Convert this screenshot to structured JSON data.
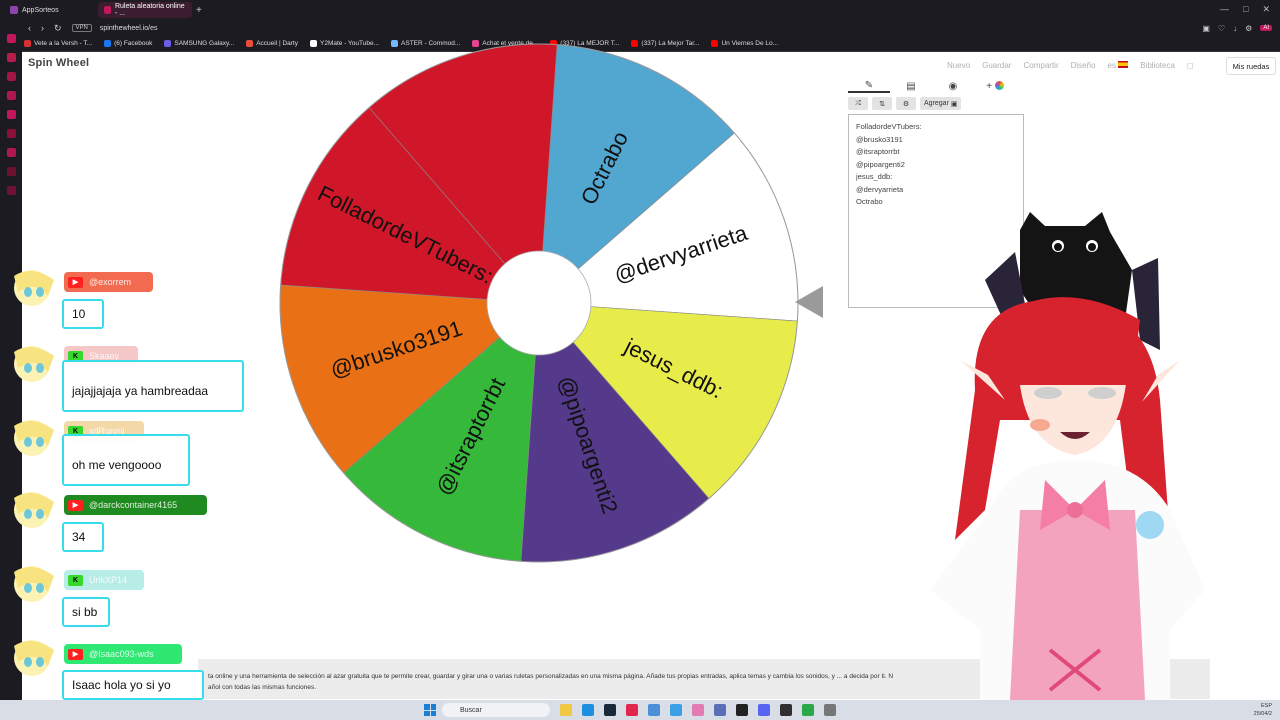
{
  "browser": {
    "tabs": [
      {
        "label": "AppSorteos"
      },
      {
        "label": "Ruleta aleatoria online - ..."
      }
    ],
    "new_tab": "+",
    "address": "spinthewheel.io/es",
    "vpn": "VPN",
    "ai": "AI",
    "bookmarks": [
      {
        "label": "Vete a la Versh - T...",
        "color": "#d63031"
      },
      {
        "label": "(6) Facebook",
        "color": "#1877f2"
      },
      {
        "label": "SAMSUNG Galaxy...",
        "color": "#6c5ce7"
      },
      {
        "label": "Accueil | Darty",
        "color": "#e74c3c"
      },
      {
        "label": "Y2Mate - YouTube...",
        "color": "#fdfdfd"
      },
      {
        "label": "ASTER - Commod...",
        "color": "#2d3436"
      },
      {
        "label": "Achat et vente de...",
        "color": "#e84393"
      },
      {
        "label": "(337) La MEJOR T...",
        "color": "#ff0000"
      },
      {
        "label": "(337) La Mejor Tar...",
        "color": "#ff0000"
      },
      {
        "label": "Un Viernes De Lo...",
        "color": "#ff0000"
      }
    ]
  },
  "site": {
    "logo": "Spin Wheel",
    "nav": {
      "new": "Nuevo",
      "save": "Guardar",
      "share": "Compartir",
      "design": "Diseño",
      "lang": "es",
      "library": "Biblioteca",
      "my_wheels": "Mis ruedas"
    },
    "panel": {
      "add_label": "Agregar",
      "entries": [
        "FolladordeVTubers:",
        "@brusko3191",
        "@itsraptorrbt",
        "@pipoargenti2",
        "jesus_ddb:",
        "@dervyarrieta",
        "Octrabo"
      ]
    },
    "info_text_1": "ta online y una herramienta de selección al azar gratuita que te permite crear, guardar y girar una o varias ruletas personalizadas en una misma página. Añade tus propias entradas, aplica temas y cambia los sonidos, y ... a decida por ti. N",
    "info_text_2": "añol con todas las mismas funciones."
  },
  "wheel_segments": [
    {
      "label": "Octrabo",
      "color": "#52a7d1"
    },
    {
      "label": "@dervyarrieta",
      "color": "#ffffff"
    },
    {
      "label": "jesus_ddb:",
      "color": "#e8ec4a"
    },
    {
      "label": "@pipoargenti2",
      "color": "#55398a"
    },
    {
      "label": "@itsraptorrbt",
      "color": "#36b83a"
    },
    {
      "label": "@brusko3191",
      "color": "#e97014"
    },
    {
      "label": "FolladordeVTubers:",
      "color": "#cf1729"
    },
    {
      "label": "",
      "color": "#cf1729"
    }
  ],
  "chat": [
    {
      "platform": "yt",
      "user": "@exorrem",
      "message": "10",
      "name_color": "#f26b50"
    },
    {
      "platform": "kick",
      "user": "Skaaoy",
      "message": "jajajjajaja ya hambreadaa",
      "name_color": "#f6c7c7"
    },
    {
      "platform": "kick",
      "user": "xdRunmi",
      "message": "oh me vengoooo",
      "name_color": "#f4d9a8"
    },
    {
      "platform": "yt",
      "user": "@darckcontainer4165",
      "message": "34",
      "name_color": "#1f8a1f"
    },
    {
      "platform": "kick",
      "user": "UrikXP14",
      "message": "si bb",
      "name_color": "#b8ece6"
    },
    {
      "platform": "yt",
      "user": "@Isaac093-wds",
      "message": "Isaac hola yo si yo",
      "name_color": "#2ee872"
    }
  ],
  "taskbar": {
    "search_placeholder": "Buscar",
    "tray_lang": "ESP",
    "tray_date": "25/04/2"
  }
}
